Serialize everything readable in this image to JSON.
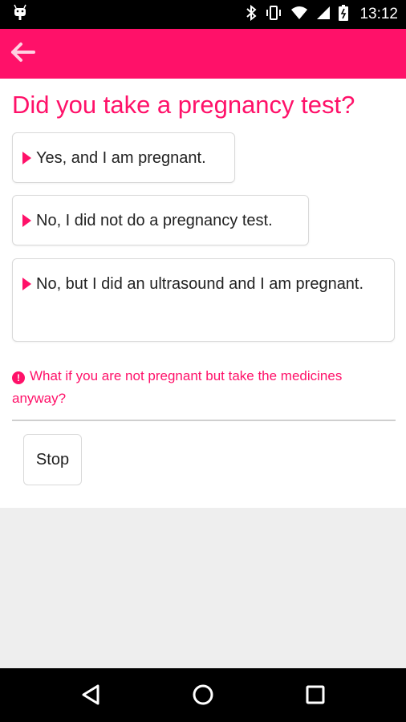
{
  "status_bar": {
    "time": "13:12",
    "icons": [
      "android-icon",
      "bluetooth-icon",
      "vibrate-icon",
      "wifi-icon",
      "signal-icon",
      "battery-icon"
    ]
  },
  "app_bar": {
    "back_icon": "arrow-left-icon",
    "color": "#ff1169"
  },
  "main": {
    "question": "Did you take a pregnancy test?",
    "options": [
      {
        "label": "Yes, and I am pregnant."
      },
      {
        "label": "No, I did not do a pregnancy test."
      },
      {
        "label": "No, but I did an ultrasound and I am pregnant."
      }
    ],
    "info_text": "What if you are not pregnant but take the medicines anyway?",
    "stop_label": "Stop"
  },
  "nav_bar": {
    "icons": [
      "back-triangle-icon",
      "home-circle-icon",
      "recents-square-icon"
    ]
  }
}
